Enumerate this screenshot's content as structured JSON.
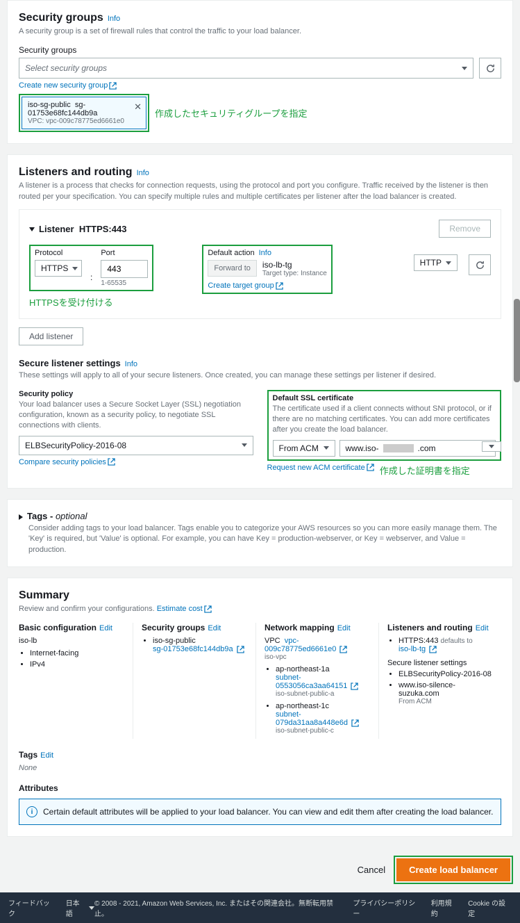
{
  "sg": {
    "title": "Security groups",
    "info": "Info",
    "desc": "A security group is a set of firewall rules that control the traffic to your load balancer.",
    "label": "Security groups",
    "placeholder": "Select security groups",
    "createLink": "Create new security group",
    "tag": {
      "name": "iso-sg-public",
      "id": "sg-01753e68fc144db9a",
      "vpc": "VPC: vpc-009c78775ed6661e0"
    },
    "annot": "作成したセキュリティグループを指定"
  },
  "lr": {
    "title": "Listeners and routing",
    "info": "Info",
    "desc": "A listener is a process that checks for connection requests, using the protocol and port you configure. Traffic received by the listener is then routed per your specification. You can specify multiple rules and multiple certificates per listener after the load balancer is created.",
    "listenerLabel": "Listener",
    "listenerValue": "HTTPS:443",
    "remove": "Remove",
    "protocolLabel": "Protocol",
    "protocol": "HTTPS",
    "portLabel": "Port",
    "port": "443",
    "portRange": "1-65535",
    "defaultAction": "Default action",
    "forwardTo": "Forward to",
    "tg": {
      "name": "iso-lb-tg",
      "type": "Target type: Instance"
    },
    "http": "HTTP",
    "createTg": "Create target group",
    "annot": "HTTPSを受け付ける",
    "add": "Add listener"
  },
  "sls": {
    "title": "Secure listener settings",
    "info": "Info",
    "desc": "These settings will apply to all of your secure listeners. Once created, you can manage these settings per listener if desired.",
    "spLabel": "Security policy",
    "spDesc": "Your load balancer uses a Secure Socket Layer (SSL) negotiation configuration, known as a security policy, to negotiate SSL connections with clients.",
    "spValue": "ELBSecurityPolicy-2016-08",
    "compare": "Compare security policies",
    "certLabel": "Default SSL certificate",
    "certDesc": "The certificate used if a client connects without SNI protocol, or if there are no matching certificates. You can add more certificates after you create the load balancer.",
    "fromAcm": "From ACM",
    "certValue1": "www.iso-",
    "certValue2": ".com",
    "request": "Request new ACM certificate",
    "annot": "作成した証明書を指定"
  },
  "tags": {
    "title": "Tags - ",
    "opt": "optional",
    "desc": "Consider adding tags to your load balancer. Tags enable you to categorize your AWS resources so you can more easily manage them. The 'Key' is required, but 'Value' is optional. For example, you can have Key = production-webserver, or Key = webserver, and Value = production."
  },
  "sum": {
    "title": "Summary",
    "desc": "Review and confirm your configurations.",
    "estimate": "Estimate cost",
    "edit": "Edit",
    "bc": {
      "h": "Basic configuration",
      "name": "iso-lb",
      "scheme": "Internet-facing",
      "ip": "IPv4"
    },
    "sg": {
      "h": "Security groups",
      "name": "iso-sg-public",
      "id": "sg-01753e68fc144db9a"
    },
    "nm": {
      "h": "Network mapping",
      "vpcLabel": "VPC",
      "vpc": "vpc-009c78775ed6661e0",
      "vpcName": "iso-vpc",
      "az1": "ap-northeast-1a",
      "sub1": "subnet-0553056ca3aa64151",
      "sub1n": "iso-subnet-public-a",
      "az2": "ap-northeast-1c",
      "sub2": "subnet-079da31aa8a448e6d",
      "sub2n": "iso-subnet-public-c"
    },
    "lr": {
      "h": "Listeners and routing",
      "proto": "HTTPS:443",
      "def": "defaults to",
      "tg": "iso-lb-tg",
      "slsH": "Secure listener settings",
      "sp": "ELBSecurityPolicy-2016-08",
      "cert": "www.iso-silence-suzuka.com",
      "acm": "From ACM"
    },
    "tagsH": "Tags",
    "none": "None",
    "attrH": "Attributes",
    "attrMsg": "Certain default attributes will be applied to your load balancer. You can view and edit them after creating the load balancer."
  },
  "btm": {
    "cancel": "Cancel",
    "create": "Create load balancer"
  },
  "footer": {
    "feedback": "フィードバック",
    "lang": "日本語",
    "copy": "© 2008 - 2021, Amazon Web Services, Inc. またはその関連会社。無断転用禁止。",
    "privacy": "プライバシーポリシー",
    "terms": "利用規約",
    "cookie": "Cookie の設定"
  }
}
